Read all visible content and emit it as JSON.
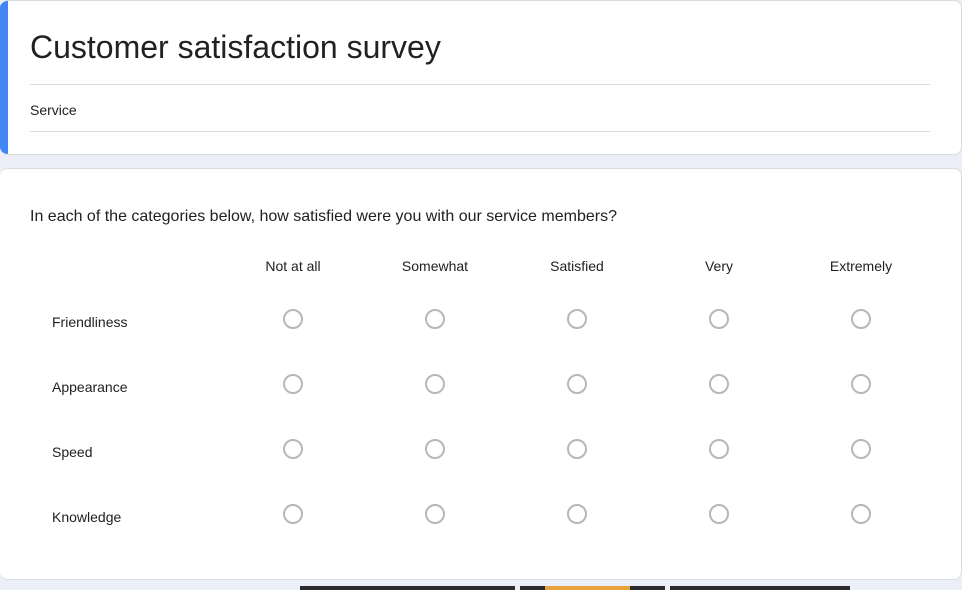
{
  "theme": {
    "accent_color": "#4285f4",
    "page_background": "#eceef8",
    "card_background": "#ffffff",
    "text_color": "#202124",
    "rule_color": "#dadce0",
    "radio_border_color": "#b5b8bb"
  },
  "header": {
    "title": "Customer satisfaction survey",
    "description": "Service"
  },
  "question": {
    "text": "In each of the categories below, how satisfied were you with our service members?",
    "columns": [
      "Not at all",
      "Somewhat",
      "Satisfied",
      "Very",
      "Extremely"
    ],
    "rows": [
      {
        "label": "Friendliness",
        "selected": null
      },
      {
        "label": "Appearance",
        "selected": null
      },
      {
        "label": "Speed",
        "selected": null
      },
      {
        "label": "Knowledge",
        "selected": null
      }
    ]
  }
}
